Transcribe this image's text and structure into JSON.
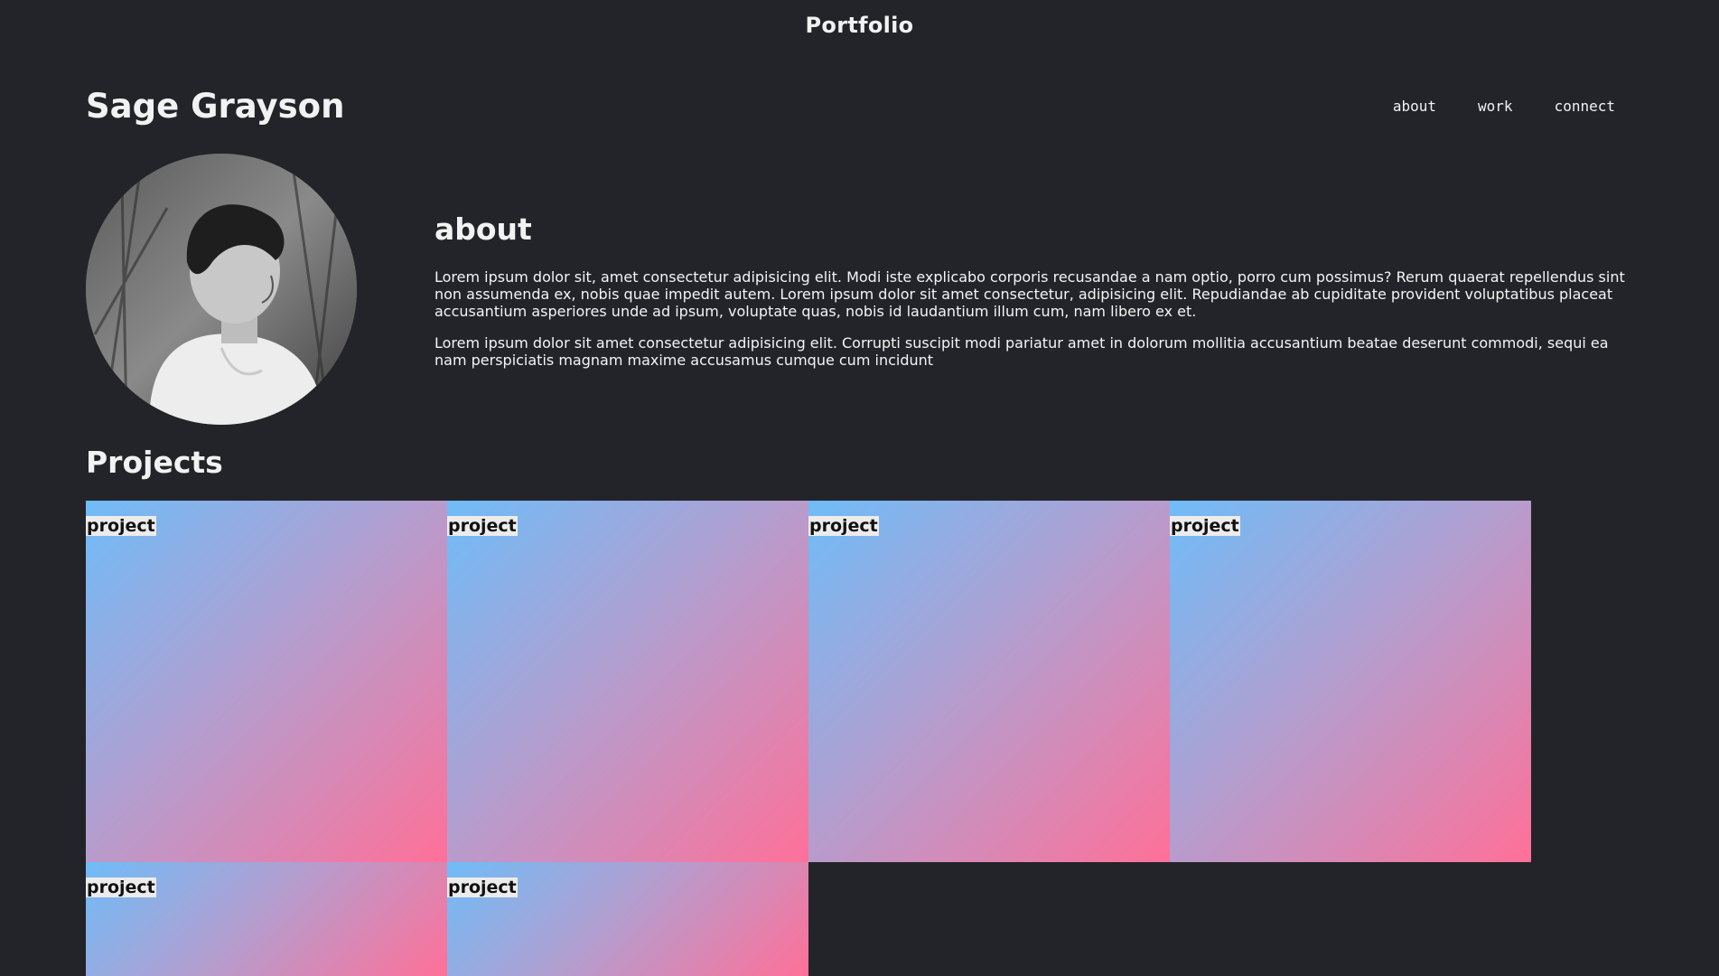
{
  "window": {
    "title": "Portfolio"
  },
  "header": {
    "name": "Sage Grayson",
    "nav": [
      {
        "label": "about"
      },
      {
        "label": "work"
      },
      {
        "label": "connect"
      }
    ]
  },
  "about": {
    "heading": "about",
    "paragraphs": [
      "Lorem ipsum dolor sit, amet consectetur adipisicing elit. Modi iste explicabo corporis recusandae a nam optio, porro cum possimus? Rerum quaerat repellendus sint non assumenda ex, nobis quae impedit autem. Lorem ipsum dolor sit amet consectetur, adipisicing elit. Repudiandae ab cupiditate provident voluptatibus placeat accusantium asperiores unde ad ipsum, voluptate quas, nobis id laudantium illum cum, nam libero ex et.",
      "Lorem ipsum dolor sit amet consectetur adipisicing elit. Corrupti suscipit modi pariatur amet in dolorum mollitia accusantium beatae deserunt commodi, sequi ea nam perspiciatis magnam maxime accusamus cumque cum incidunt"
    ]
  },
  "projects": {
    "heading": "Projects",
    "items": [
      {
        "label": "project"
      },
      {
        "label": "project"
      },
      {
        "label": "project"
      },
      {
        "label": "project"
      },
      {
        "label": "project"
      },
      {
        "label": "project"
      }
    ]
  },
  "colors": {
    "background": "#232429",
    "gradient_start": "#6fbcf8",
    "gradient_end": "#ff7098"
  }
}
